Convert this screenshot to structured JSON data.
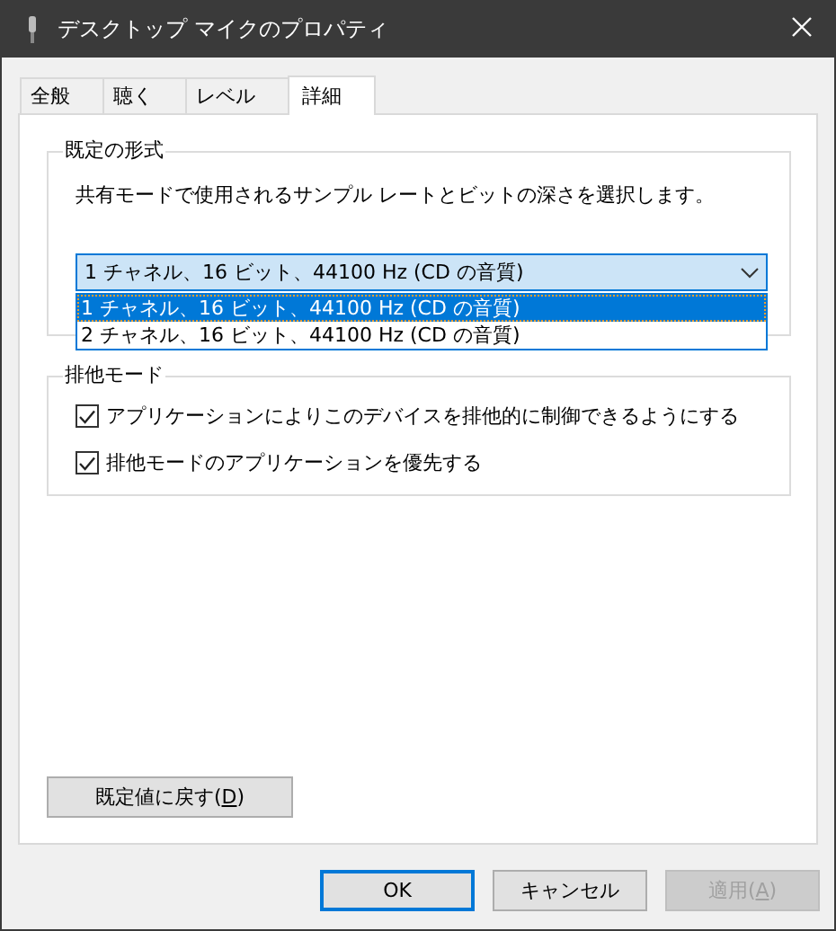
{
  "window": {
    "title": "デスクトップ マイクのプロパティ"
  },
  "tabs": [
    {
      "label": "全般",
      "selected": false
    },
    {
      "label": "聴く",
      "selected": false
    },
    {
      "label": "レベル",
      "selected": false
    },
    {
      "label": "詳細",
      "selected": true
    }
  ],
  "default_format": {
    "title": "既定の形式",
    "description": "共有モードで使用されるサンプル レートとビットの深さを選択します。",
    "combo": {
      "value": "1 チャネル、16 ビット、44100 Hz (CD の音質)",
      "open": true,
      "options": [
        {
          "label": "1 チャネル、16 ビット、44100 Hz (CD の音質)",
          "selected": true
        },
        {
          "label": "2 チャネル、16 ビット、44100 Hz (CD の音質)",
          "selected": false
        }
      ]
    }
  },
  "exclusive_mode": {
    "title": "排他モード",
    "options": [
      {
        "label": "アプリケーションによりこのデバイスを排他的に制御できるようにする",
        "checked": true
      },
      {
        "label": "排他モードのアプリケーションを優先する",
        "checked": true
      }
    ]
  },
  "restore_button": {
    "label_parts": [
      "既定値に戻す(",
      "D",
      ")"
    ]
  },
  "buttons": [
    {
      "label_parts": [
        "OK"
      ],
      "default": true,
      "disabled": false
    },
    {
      "label_parts": [
        "キャンセル"
      ],
      "default": false,
      "disabled": false
    },
    {
      "label_parts": [
        "適用(",
        "A",
        ")"
      ],
      "default": false,
      "disabled": true
    }
  ]
}
